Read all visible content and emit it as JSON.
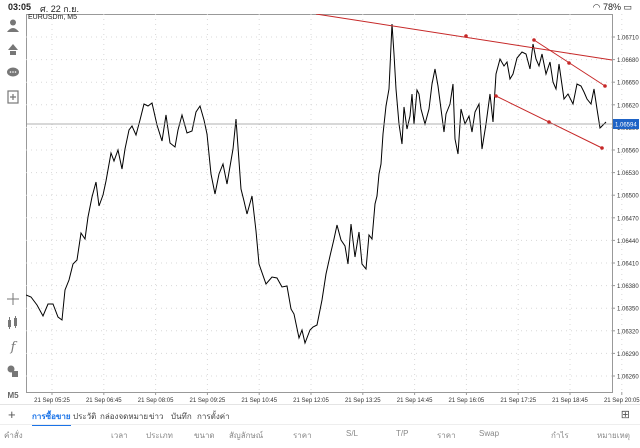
{
  "status": {
    "time": "03:05",
    "date": "ศ. 22 ก.ย.",
    "battery": "78%"
  },
  "chart": {
    "symbol": "EURUSDm, M5",
    "current_price": "1.06594",
    "price_ticks": [
      "1.06710",
      "1.06680",
      "1.06650",
      "1.06620",
      "1.06590",
      "1.06560",
      "1.06530",
      "1.06500",
      "1.06470",
      "1.06440",
      "1.06410",
      "1.06380",
      "1.06350",
      "1.06320",
      "1.06290",
      "1.06260"
    ],
    "time_ticks": [
      "21 Sep 05:25",
      "21 Sep 06:45",
      "21 Sep 08:05",
      "21 Sep 09:25",
      "21 Sep 10:45",
      "21 Sep 12:05",
      "21 Sep 13:25",
      "21 Sep 14:45",
      "21 Sep 16:05",
      "21 Sep 17:25",
      "21 Sep 18:45",
      "21 Sep 20:05"
    ]
  },
  "toolbar": {
    "timeframe": "M5"
  },
  "tabs": [
    "การซื้อขาย",
    "ประวัติ",
    "กล่องจดหมาย",
    "ข่าว",
    "บันทึก",
    "การตั้งค่า"
  ],
  "columns": [
    "คำสั่ง",
    "เวลา",
    "ประเภท",
    "ขนาด",
    "สัญลักษณ์",
    "ราคา",
    "S/L",
    "T/P",
    "ราคา",
    "Swap",
    "กำไร",
    "หมายเหตุ"
  ]
}
